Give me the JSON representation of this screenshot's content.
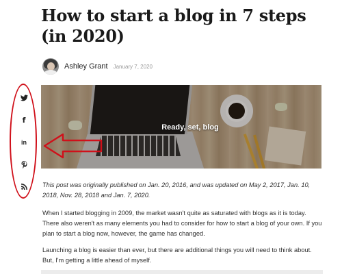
{
  "article": {
    "title": "How to start a blog in 7 steps (in 2020)",
    "author": "Ashley Grant",
    "date": "January 7, 2020"
  },
  "social": {
    "icons": [
      {
        "name": "twitter-icon",
        "glyph": "🐦"
      },
      {
        "name": "facebook-icon",
        "glyph": "f"
      },
      {
        "name": "linkedin-icon",
        "glyph": "in"
      },
      {
        "name": "pinterest-icon",
        "glyph": "P"
      },
      {
        "name": "rss-icon",
        "glyph": "rss"
      }
    ],
    "highlight_color": "#d0101a"
  },
  "hero": {
    "caption": "Ready, set, blog"
  },
  "content": {
    "update_note": "This post was originally published on Jan. 20, 2016, and was updated on May 2, 2017, Jan. 10, 2018, Nov. 28, 2018 and Jan. 7, 2020.",
    "paragraph_1": "When I started blogging in 2009, the market wasn't quite as saturated with blogs as it is today. There also weren't as many elements you had to consider for how to start a blog of your own. If you plan to start a blog now, however, the game has changed.",
    "paragraph_2": "Launching a blog is easier than ever, but there are additional things you will need to think about. But, I'm getting a little ahead of myself."
  }
}
